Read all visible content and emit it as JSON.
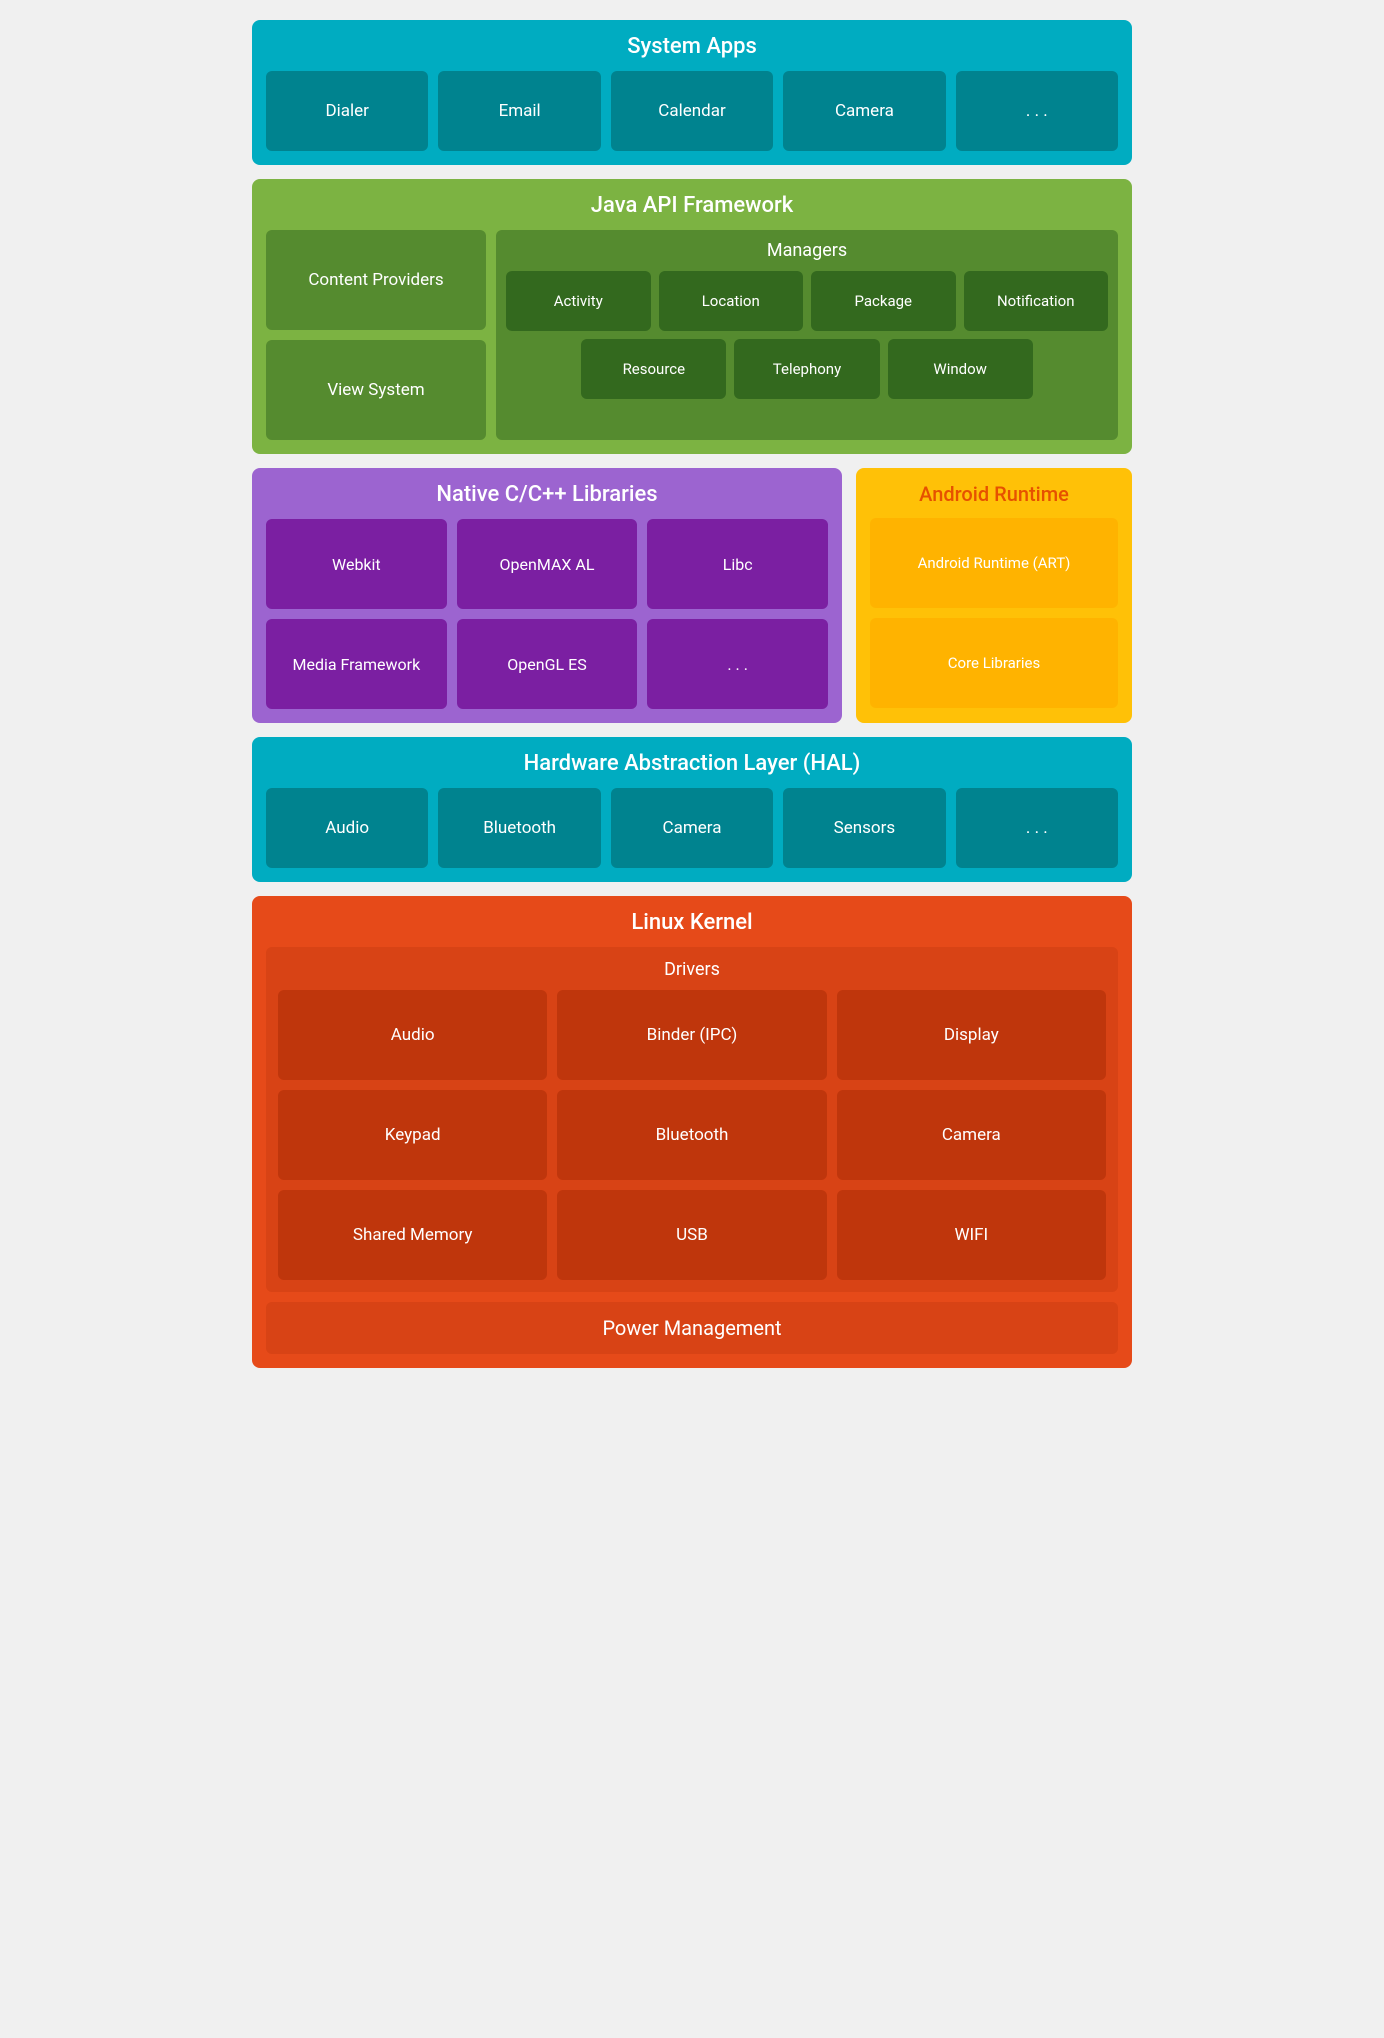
{
  "system_apps": {
    "title": "System Apps",
    "tiles": [
      "Dialer",
      "Email",
      "Calendar",
      "Camera",
      ". . ."
    ]
  },
  "java_api": {
    "title": "Java API Framework",
    "left_tiles": [
      "Content Providers",
      "View System"
    ],
    "managers_title": "Managers",
    "managers_row1": [
      "Activity",
      "Location",
      "Package",
      "Notification"
    ],
    "managers_row2": [
      "Resource",
      "Telephony",
      "Window"
    ]
  },
  "native_libs": {
    "title": "Native C/C++ Libraries",
    "tiles": [
      "Webkit",
      "OpenMAX AL",
      "Libc",
      "Media Framework",
      "OpenGL ES",
      ". . ."
    ]
  },
  "android_runtime": {
    "title": "Android Runtime",
    "tiles": [
      "Android Runtime (ART)",
      "Core Libraries"
    ]
  },
  "hal": {
    "title": "Hardware Abstraction Layer (HAL)",
    "tiles": [
      "Audio",
      "Bluetooth",
      "Camera",
      "Sensors",
      ". . ."
    ]
  },
  "linux_kernel": {
    "title": "Linux Kernel",
    "drivers_title": "Drivers",
    "drivers": [
      "Audio",
      "Binder (IPC)",
      "Display",
      "Keypad",
      "Bluetooth",
      "Camera",
      "Shared Memory",
      "USB",
      "WIFI"
    ],
    "power_management": "Power Management"
  }
}
